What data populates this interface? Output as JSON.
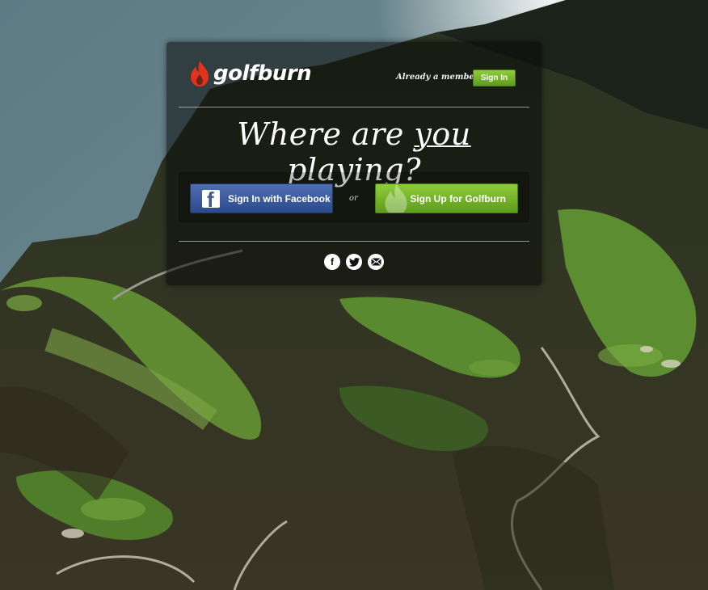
{
  "brand": {
    "name": "golfburn",
    "accent": "#6fb22a",
    "flame_color": "#e0321c"
  },
  "header": {
    "member_prompt": "Already a member?",
    "signin_label": "Sign In"
  },
  "hero": {
    "headline_before": "Where are ",
    "headline_emph": "you",
    "headline_after": " playing?"
  },
  "actions": {
    "facebook_label": "Sign In with Facebook",
    "or_label": "or",
    "signup_label": "Sign Up for Golfburn"
  },
  "social": {
    "icons": [
      "facebook-icon",
      "twitter-icon",
      "email-icon"
    ]
  }
}
